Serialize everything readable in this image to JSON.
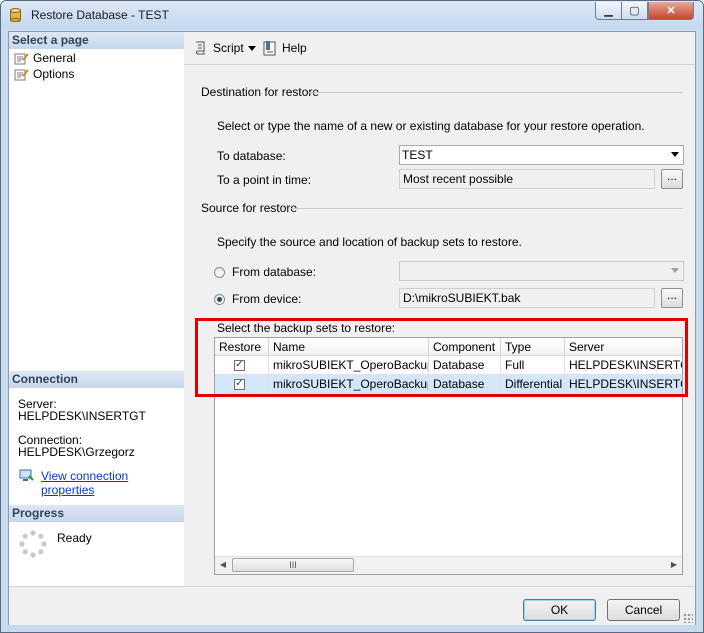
{
  "window": {
    "title": "Restore Database - TEST"
  },
  "left_pane": {
    "select_page_header": "Select a page",
    "pages": [
      {
        "label": "General",
        "icon": "page-icon"
      },
      {
        "label": "Options",
        "icon": "page-icon"
      }
    ],
    "connection_header": "Connection",
    "server_label": "Server:",
    "server_value": "HELPDESK\\INSERTGT",
    "connection_label": "Connection:",
    "connection_value": "HELPDESK\\Grzegorz",
    "view_connection_link": "View connection properties",
    "progress_header": "Progress",
    "progress_status": "Ready"
  },
  "toolbar": {
    "script_label": "Script",
    "help_label": "Help"
  },
  "destination": {
    "group_label": "Destination for restore",
    "instruction": "Select or type the name of a new or existing database for your restore operation.",
    "to_database_label": "To database:",
    "to_database_value": "TEST",
    "point_in_time_label": "To a point in time:",
    "point_in_time_value": "Most recent possible",
    "browse_label": "..."
  },
  "source": {
    "group_label": "Source for restore",
    "instruction": "Specify the source and location of backup sets to restore.",
    "from_database_label": "From database:",
    "from_device_label": "From device:",
    "device_value": "D:\\mikroSUBIEKT.bak",
    "selected_option": "From device",
    "browse_label": "..."
  },
  "backup_sets": {
    "label": "Select the backup sets to restore:",
    "columns": [
      "Restore",
      "Name",
      "Component",
      "Type",
      "Server"
    ],
    "rows": [
      {
        "restore": "checked",
        "check_glyph": "✓",
        "name": "mikroSUBIEKT_OperoBackup",
        "component": "Database",
        "type": "Full",
        "server": "HELPDESK\\INSERTGT"
      },
      {
        "restore": "checked",
        "check_glyph": "✓",
        "name": "mikroSUBIEKT_OperoBackup",
        "component": "Database",
        "type": "Differential",
        "server": "HELPDESK\\INSERTGT"
      }
    ],
    "scroll_left": "◀",
    "scroll_thumb": "III",
    "scroll_right": "▶"
  },
  "buttons": {
    "ok": "OK",
    "cancel": "Cancel"
  },
  "colors": {
    "highlight": "#e00000",
    "link": "#0b36c9",
    "selection": "#d4e6fa"
  }
}
